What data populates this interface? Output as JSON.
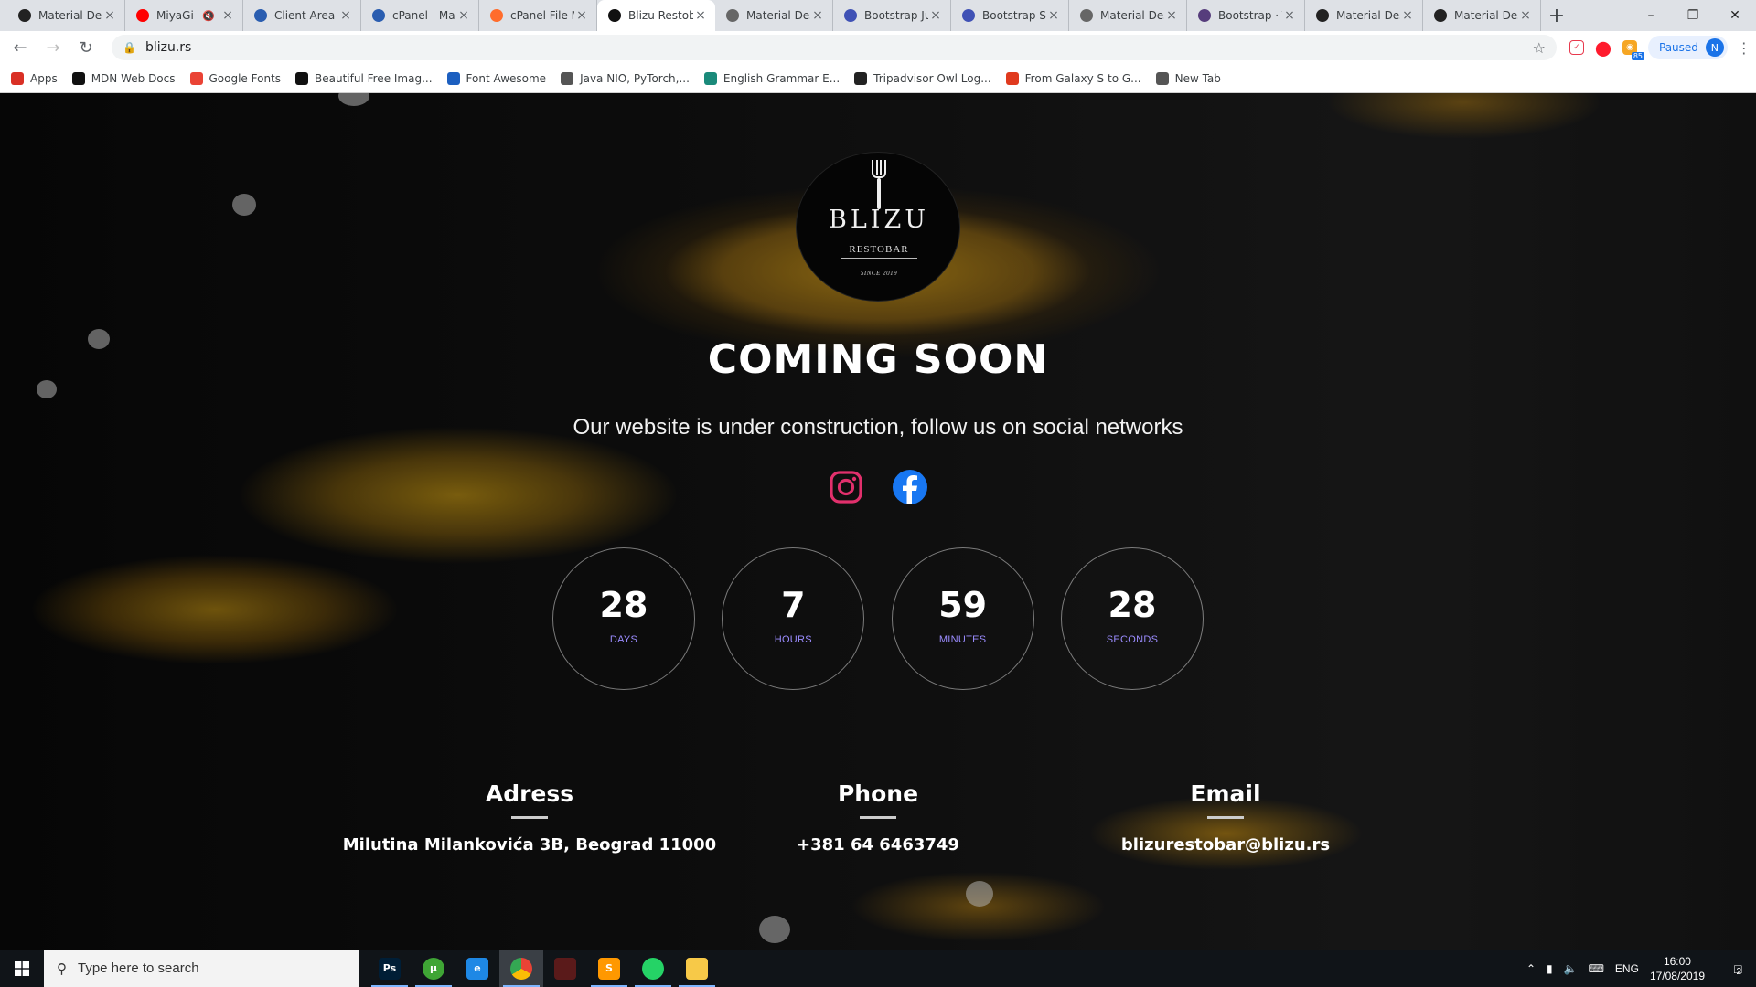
{
  "browser": {
    "tabs": [
      {
        "title": "Material Des",
        "favicon_color": "#222222",
        "active": false
      },
      {
        "title": "MiyaGi - ",
        "favicon_color": "#ff0000",
        "active": false,
        "muted": true
      },
      {
        "title": "Client Area -",
        "favicon_color": "#2a5db0",
        "active": false
      },
      {
        "title": "cPanel - Ma",
        "favicon_color": "#2a5db0",
        "active": false
      },
      {
        "title": "cPanel File M",
        "favicon_color": "#ff6c2c",
        "active": false
      },
      {
        "title": "Blizu Restob",
        "favicon_color": "#111111",
        "active": true
      },
      {
        "title": "Material Des",
        "favicon_color": "#666666",
        "active": false
      },
      {
        "title": "Bootstrap Ju",
        "favicon_color": "#3f51b5",
        "active": false
      },
      {
        "title": "Bootstrap St",
        "favicon_color": "#3f51b5",
        "active": false
      },
      {
        "title": "Material Des",
        "favicon_color": "#666666",
        "active": false
      },
      {
        "title": "Bootstrap · T",
        "favicon_color": "#563d7c",
        "active": false
      },
      {
        "title": "Material Des",
        "favicon_color": "#222222",
        "active": false
      },
      {
        "title": "Material Des",
        "favicon_color": "#222222",
        "active": false
      }
    ],
    "url": "blizu.rs",
    "profile_status": "Paused",
    "profile_initial": "N",
    "ext_badge": "85",
    "bookmarks": [
      {
        "label": "Apps",
        "color": "#d93025"
      },
      {
        "label": "MDN Web Docs",
        "color": "#111111"
      },
      {
        "label": "Google Fonts",
        "color": "#ea4335"
      },
      {
        "label": "Beautiful Free Imag...",
        "color": "#111111"
      },
      {
        "label": "Font Awesome",
        "color": "#1c5fc0"
      },
      {
        "label": "Java NIO, PyTorch,...",
        "color": "#555555"
      },
      {
        "label": "English Grammar E...",
        "color": "#1a8a7a"
      },
      {
        "label": "Tripadvisor Owl Log...",
        "color": "#222222"
      },
      {
        "label": "From Galaxy S to G...",
        "color": "#e03a1e"
      },
      {
        "label": "New Tab",
        "color": "#555555"
      }
    ]
  },
  "site": {
    "logo": {
      "name": "BLIZU",
      "subtitle": "RESTOBAR",
      "since": "SINCE 2019"
    },
    "headline": "COMING SOON",
    "tagline": "Our website is under construction, follow us on social networks",
    "social": [
      {
        "name": "instagram",
        "color": "#e1306c"
      },
      {
        "name": "facebook",
        "color": "#1877f2"
      }
    ],
    "countdown": [
      {
        "value": "28",
        "unit": "DAYS"
      },
      {
        "value": "7",
        "unit": "HOURS"
      },
      {
        "value": "59",
        "unit": "MINUTES"
      },
      {
        "value": "28",
        "unit": "SECONDS"
      }
    ],
    "contacts": [
      {
        "title": "Adress",
        "value": "Milutina Milankovića 3B, Beograd 11000"
      },
      {
        "title": "Phone",
        "value": "+381 64 6463749"
      },
      {
        "title": "Email",
        "value": "blizurestobar@blizu.rs"
      }
    ],
    "accent_color": "#9b8cff"
  },
  "taskbar": {
    "search_placeholder": "Type here to search",
    "apps": [
      {
        "name": "photoshop",
        "label": "Ps",
        "color": "#001e36"
      },
      {
        "name": "utorrent",
        "label": "µ",
        "color": "#3fa535"
      },
      {
        "name": "edge",
        "label": "e",
        "color": "#1e88e5"
      },
      {
        "name": "chrome",
        "label": "",
        "color": "#e8453c",
        "active": true
      },
      {
        "name": "app-red",
        "label": "",
        "color": "#5a1a1a"
      },
      {
        "name": "sublime",
        "label": "S",
        "color": "#ff9800"
      },
      {
        "name": "whatsapp",
        "label": "",
        "color": "#25d366"
      },
      {
        "name": "file-explorer",
        "label": "",
        "color": "#f7c948"
      }
    ],
    "lang": "ENG",
    "time": "16:00",
    "date": "17/08/2019",
    "notifications": "2"
  }
}
